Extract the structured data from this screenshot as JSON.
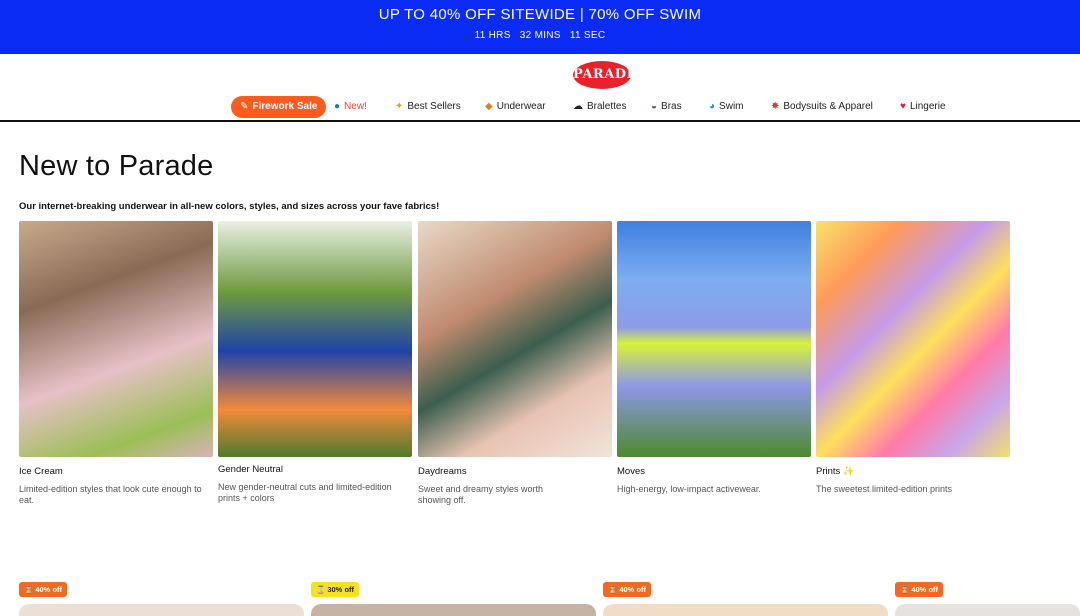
{
  "promo": {
    "title": "UP TO 40% OFF SITEWIDE | 70% OFF SWIM",
    "hours": "11 HRS",
    "mins": "32 MINS",
    "secs": "11 SEC",
    "bg_color": "#0b2cf5"
  },
  "brand": {
    "logo": "PARADE",
    "color": "#e8212a"
  },
  "nav": [
    {
      "label": "Firework Sale",
      "icon": "firework-icon",
      "glyph": "✎"
    },
    {
      "label": "New!",
      "icon": "new-icon",
      "glyph": "●"
    },
    {
      "label": "Best Sellers",
      "icon": "best-sellers-icon",
      "glyph": "✦"
    },
    {
      "label": "Underwear",
      "icon": "underwear-icon",
      "glyph": "◆"
    },
    {
      "label": "Bralettes",
      "icon": "bralette-icon",
      "glyph": "☁"
    },
    {
      "label": "Bras",
      "icon": "bra-icon",
      "glyph": "◒"
    },
    {
      "label": "Swim",
      "icon": "swim-icon",
      "glyph": "◕"
    },
    {
      "label": "Bodysuits & Apparel",
      "icon": "bodysuit-icon",
      "glyph": "✸"
    },
    {
      "label": "Lingerie",
      "icon": "lingerie-icon",
      "glyph": "♥"
    }
  ],
  "page": {
    "title": "New to Parade",
    "subtitle": "Our internet-breaking underwear in all-new colors, styles, and sizes across your fave fabrics!"
  },
  "collections": [
    {
      "name": "Ice Cream",
      "desc": "Limited-edition styles that look cute enough to eat."
    },
    {
      "name": "Gender Neutral",
      "desc": "New gender-neutral cuts and limited-edition prints + colors"
    },
    {
      "name": "Daydreams",
      "desc": "Sweet and dreamy styles worth showing off."
    },
    {
      "name": "Moves",
      "desc": "High-energy, low-impact activewear."
    },
    {
      "name": "Prints ✨",
      "desc": "The sweetest limited-edition prints"
    }
  ],
  "badges": [
    {
      "label": "40% off",
      "icon": "hourglass-icon",
      "color": "#f26a21"
    },
    {
      "label": "30% off",
      "icon": "hourglass-icon",
      "color": "#f5e21f"
    },
    {
      "label": "40% off",
      "icon": "hourglass-icon",
      "color": "#f26a21"
    },
    {
      "label": "40% off",
      "icon": "hourglass-icon",
      "color": "#f26a21"
    }
  ]
}
